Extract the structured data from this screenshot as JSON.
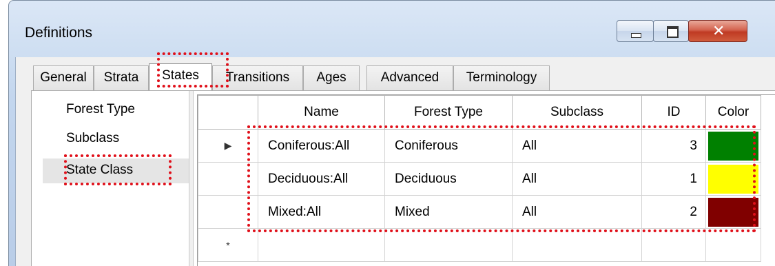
{
  "window": {
    "title": "Definitions"
  },
  "tabs": [
    {
      "label": "General"
    },
    {
      "label": "Strata"
    },
    {
      "label": "States",
      "active": true
    },
    {
      "label": "Transitions"
    },
    {
      "label": "Ages"
    },
    {
      "label": "Advanced"
    },
    {
      "label": "Terminology"
    }
  ],
  "left_list": [
    "Forest Type",
    "Subclass",
    "State Class"
  ],
  "left_selected": "State Class",
  "grid": {
    "columns": [
      "Name",
      "Forest Type",
      "Subclass",
      "ID",
      "Color"
    ],
    "rows": [
      {
        "marker": "▶",
        "name": "Coniferous:All",
        "forest_type": "Coniferous",
        "subclass": "All",
        "id": "3",
        "color": "#008000"
      },
      {
        "marker": "",
        "name": "Deciduous:All",
        "forest_type": "Deciduous",
        "subclass": "All",
        "id": "1",
        "color": "#ffff00"
      },
      {
        "marker": "",
        "name": "Mixed:All",
        "forest_type": "Mixed",
        "subclass": "All",
        "id": "2",
        "color": "#800000"
      }
    ],
    "new_row_marker": "*"
  },
  "highlight_color": "#e0101a"
}
